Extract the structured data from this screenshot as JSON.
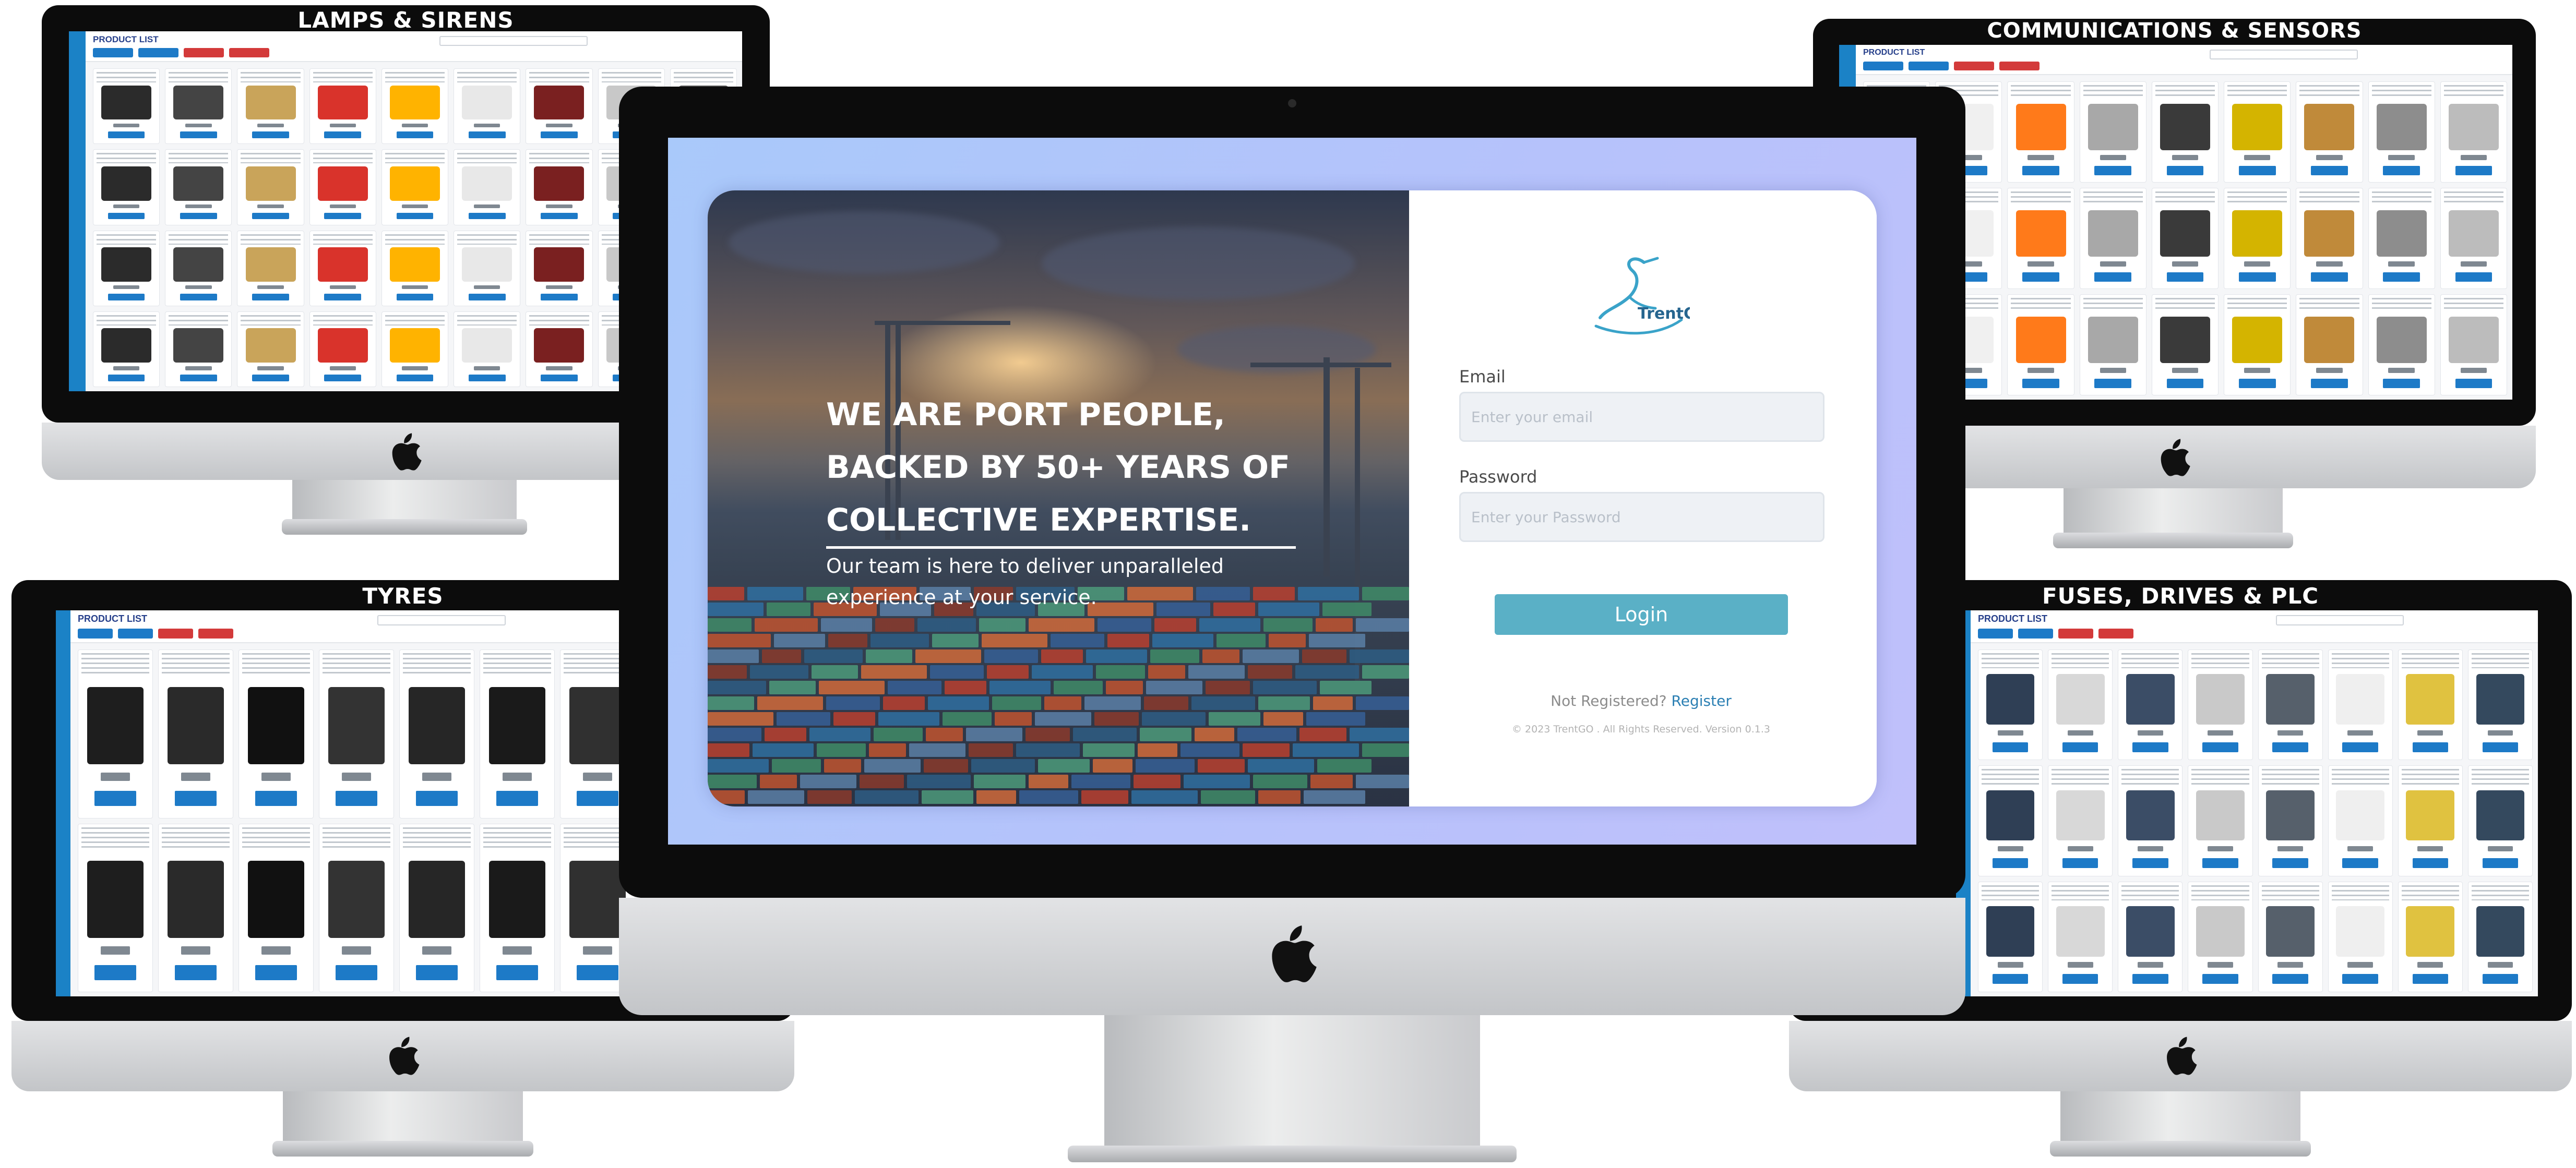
{
  "captions": {
    "lamps": "LAMPS & SIRENS",
    "comms": "COMMUNICATIONS & SENSORS",
    "tyres": "TYRES",
    "fuses": "FUSES, DRIVES & PLC"
  },
  "mini_app": {
    "title": "PRODUCT LIST",
    "chip_colors": [
      "#1d7ac7",
      "#1d7ac7",
      "#d33a3a",
      "#d33a3a"
    ]
  },
  "login": {
    "brand": "TrentGO",
    "headline": "WE ARE PORT PEOPLE, BACKED BY 50+ YEARS OF COLLECTIVE EXPERTISE.",
    "subtext": "Our team is here to deliver unparalleled experience at your service.",
    "email_label": "Email",
    "email_placeholder": "Enter your email",
    "password_label": "Password",
    "password_placeholder": "Enter your Password",
    "login_button": "Login",
    "not_registered": "Not Registered?",
    "register_link": "Register",
    "copyright": "© 2023 TrentGO . All Rights Reserved. Version 0.1.3"
  },
  "colors": {
    "accent_blue": "#1b82c6",
    "login_button": "#5ab0c6",
    "register_link": "#2b7fb3",
    "add_to_cart": "#1d7ac7"
  },
  "icons": [
    "apple-logo-icon",
    "trentgo-heron-logo-icon",
    "camera-icon"
  ]
}
